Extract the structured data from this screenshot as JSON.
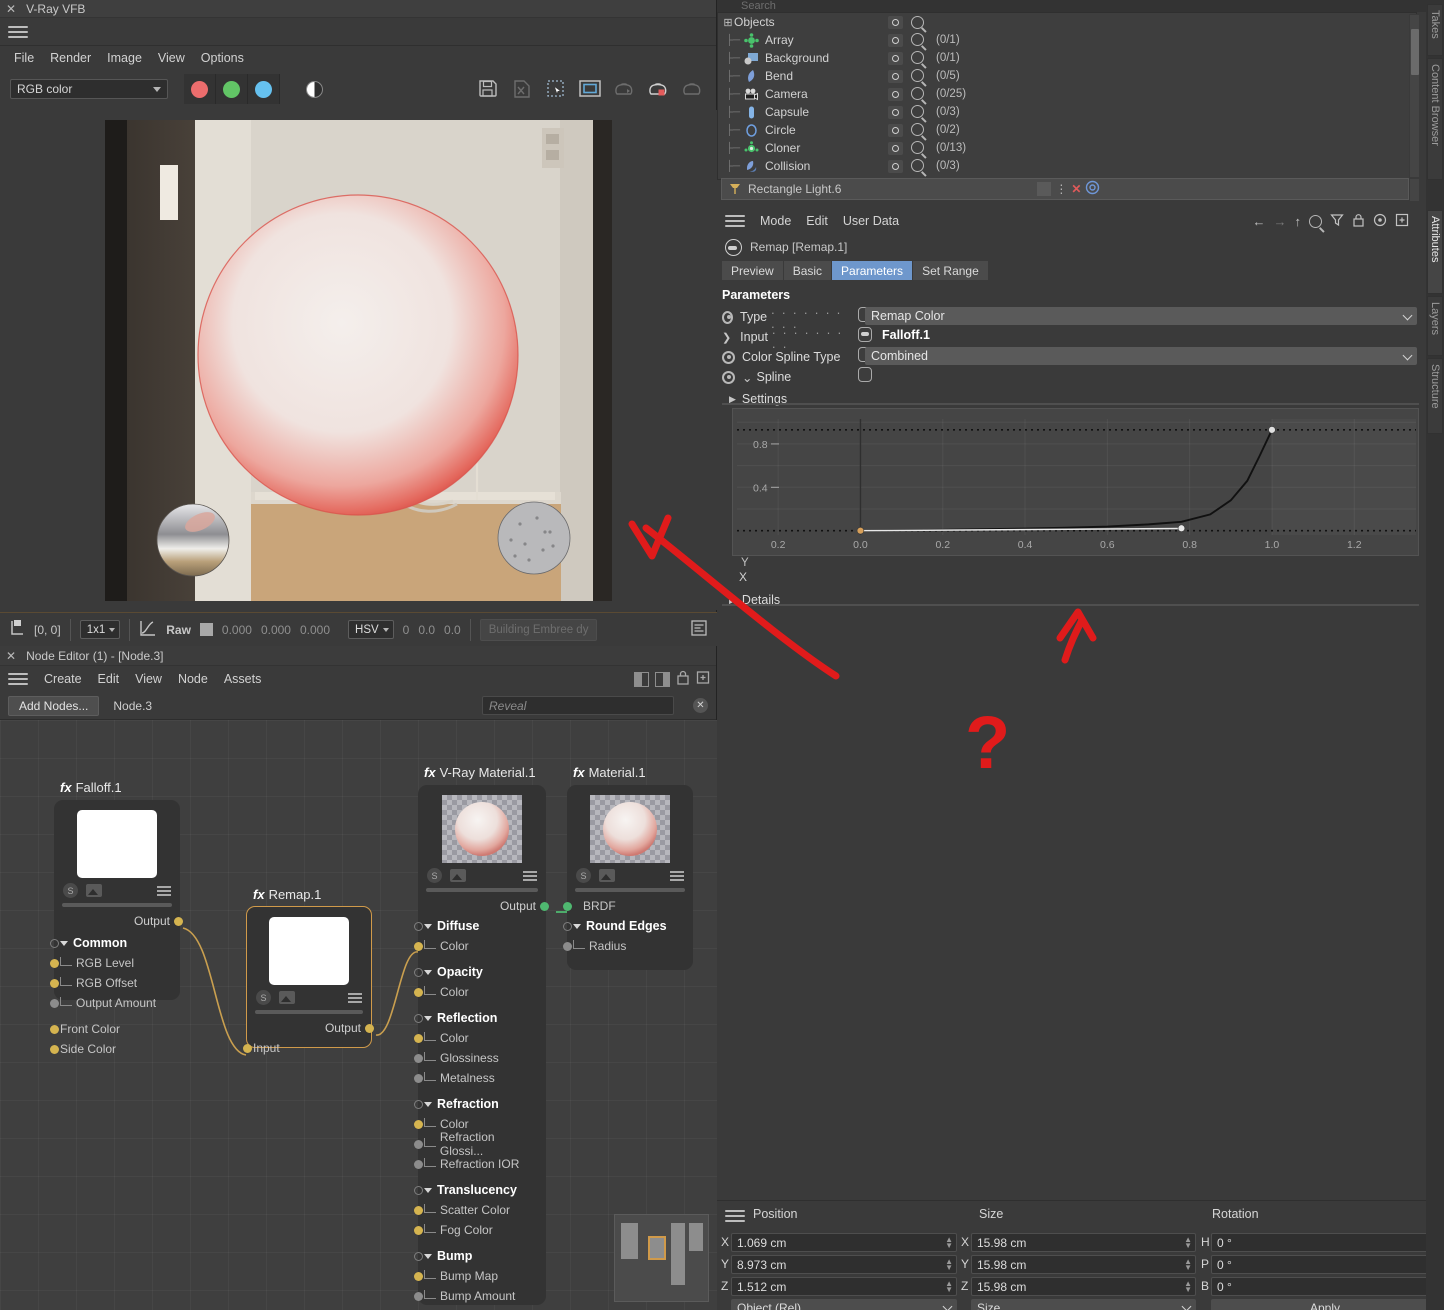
{
  "vfb": {
    "window_title": "V-Ray VFB",
    "close_icon": "close-icon",
    "menu": [
      "File",
      "Render",
      "Image",
      "View",
      "Options"
    ],
    "channel_select": "RGB color",
    "channel_buttons": [
      "red-channel",
      "green-channel",
      "blue-channel",
      "alpha-channel"
    ],
    "toolbar_icons": [
      "save-image-icon",
      "save-region-icon",
      "region-select-icon",
      "frame-icon",
      "teapot-render-icon",
      "teapot-region-icon",
      "teapot-stop-icon"
    ],
    "colors": {
      "red": "#ec6d6d",
      "green": "#62c566",
      "blue": "#66c1ef"
    },
    "status": {
      "pixel_coord": "[0, 0]",
      "zoom": "1x1",
      "mode_label": "Raw",
      "raw_values": [
        "0.000",
        "0.000",
        "0.000"
      ],
      "color_space": "HSV",
      "hsv_values": [
        "0",
        "0.0",
        "0.0"
      ],
      "progress_text": "Building Embree dy"
    }
  },
  "node_editor": {
    "title": "Node Editor (1) - [Node.3]",
    "menu": [
      "Create",
      "Edit",
      "View",
      "Node",
      "Assets"
    ],
    "add_nodes_label": "Add Nodes...",
    "node_path": "Node.3",
    "reveal_placeholder": "Reveal",
    "nodes": [
      {
        "id": "falloff",
        "prefix": "fx",
        "title": "Falloff.1",
        "selected": false,
        "thumb": "white",
        "out_label": "Output",
        "ports": [
          {
            "label": "Common",
            "group": true,
            "dot": "hollow"
          },
          {
            "label": "RGB Level",
            "group": false,
            "dot": "y"
          },
          {
            "label": "RGB Offset",
            "group": false,
            "dot": "y"
          },
          {
            "label": "Output Amount",
            "group": false,
            "dot": "gy"
          },
          {
            "label": "Front Color",
            "group": false,
            "dot": "y",
            "nolink": true
          },
          {
            "label": "Side Color",
            "group": false,
            "dot": "y",
            "nolink": true
          }
        ]
      },
      {
        "id": "remap",
        "prefix": "fx",
        "title": "Remap.1",
        "selected": true,
        "thumb": "white",
        "out_label": "Output",
        "in_label": "Input"
      },
      {
        "id": "vraymat",
        "prefix": "fx",
        "title": "V-Ray Material.1",
        "selected": false,
        "thumb": "sphere",
        "out_label": "Output",
        "ports": [
          {
            "label": "Diffuse",
            "group": true,
            "dot": "hollow"
          },
          {
            "label": "Color",
            "group": false,
            "dot": "y"
          },
          {
            "label": "Opacity",
            "group": true,
            "dot": "hollow"
          },
          {
            "label": "Color",
            "group": false,
            "dot": "y"
          },
          {
            "label": "Reflection",
            "group": true,
            "dot": "hollow"
          },
          {
            "label": "Color",
            "group": false,
            "dot": "y"
          },
          {
            "label": "Glossiness",
            "group": false,
            "dot": "gy"
          },
          {
            "label": "Metalness",
            "group": false,
            "dot": "gy"
          },
          {
            "label": "Refraction",
            "group": true,
            "dot": "hollow"
          },
          {
            "label": "Color",
            "group": false,
            "dot": "y"
          },
          {
            "label": "Refraction Glossi...",
            "group": false,
            "dot": "gy"
          },
          {
            "label": "Refraction IOR",
            "group": false,
            "dot": "gy"
          },
          {
            "label": "Translucency",
            "group": true,
            "dot": "hollow"
          },
          {
            "label": "Scatter Color",
            "group": false,
            "dot": "y"
          },
          {
            "label": "Fog Color",
            "group": false,
            "dot": "y"
          },
          {
            "label": "Bump",
            "group": true,
            "dot": "hollow"
          },
          {
            "label": "Bump Map",
            "group": false,
            "dot": "y"
          },
          {
            "label": "Bump Amount",
            "group": false,
            "dot": "gy"
          }
        ]
      },
      {
        "id": "material",
        "prefix": "fx",
        "title": "Material.1",
        "selected": false,
        "thumb": "sphere",
        "ports": [
          {
            "label": "BRDF",
            "group": false,
            "dot": "gr",
            "nolink": true
          },
          {
            "label": "Round Edges",
            "group": true,
            "dot": "hollow"
          },
          {
            "label": "Radius",
            "group": false,
            "dot": "gy"
          }
        ]
      }
    ]
  },
  "object_manager": {
    "search_placeholder": "Search",
    "root": "Objects",
    "items": [
      {
        "label": "Array",
        "count": "(0/1)",
        "icon": "array-icon",
        "color": "#49c26c"
      },
      {
        "label": "Background",
        "count": "(0/1)",
        "icon": "background-icon",
        "color": "#7fa9d4"
      },
      {
        "label": "Bend",
        "count": "(0/5)",
        "icon": "bend-icon",
        "color": "#7e9fd9"
      },
      {
        "label": "Camera",
        "count": "(0/25)",
        "icon": "camera-icon",
        "color": "#d8d8d8"
      },
      {
        "label": "Capsule",
        "count": "(0/3)",
        "icon": "capsule-icon",
        "color": "#85b4e6"
      },
      {
        "label": "Circle",
        "count": "(0/2)",
        "icon": "circle-icon",
        "color": "#6f9fe0"
      },
      {
        "label": "Cloner",
        "count": "(0/13)",
        "icon": "cloner-icon",
        "color": "#49c26c"
      },
      {
        "label": "Collision",
        "count": "(0/3)",
        "icon": "collision-icon",
        "color": "#7e9fd9"
      }
    ],
    "selected_object": "Rectangle Light.6"
  },
  "attributes": {
    "menu": [
      "Mode",
      "Edit",
      "User Data"
    ],
    "toolbar_icons": [
      "back-arrow-icon",
      "forward-arrow-icon",
      "up-arrow-icon",
      "search-icon",
      "filter-icon",
      "lock-icon",
      "target-icon",
      "new-window-icon"
    ],
    "object_header": "Remap [Remap.1]",
    "tabs": [
      {
        "label": "Preview",
        "active": false
      },
      {
        "label": "Basic",
        "active": false
      },
      {
        "label": "Parameters",
        "active": true
      },
      {
        "label": "Set Range",
        "active": false
      }
    ],
    "section_title": "Parameters",
    "rows": [
      {
        "label": "Type",
        "dots": ". . . . . . . . . .",
        "value": "Remap Color",
        "kind": "dropdown"
      },
      {
        "label": "Input",
        "dots": ". . . . . . . . .",
        "value": "Falloff.1",
        "kind": "link"
      },
      {
        "label": "Color Spline Type",
        "dots": "",
        "value": "Combined",
        "kind": "dropdown"
      },
      {
        "label": "Spline",
        "dots": "",
        "value": "",
        "kind": "collapse"
      }
    ],
    "settings_label": "Settings",
    "details_label": "Details",
    "accent": "#6e97cc"
  },
  "chart_data": {
    "type": "line",
    "title": "",
    "xlabel": "X",
    "ylabel": "Y",
    "xticks": [
      "0.2",
      "0.0",
      "0.2",
      "0.4",
      "0.6",
      "0.8",
      "1.0",
      "1.2"
    ],
    "yticks": [
      "0.8",
      "0.4"
    ],
    "xlim": [
      -0.3,
      1.35
    ],
    "ylim": [
      -0.04,
      1.03
    ],
    "series": [
      {
        "name": "spline",
        "color": "#111111",
        "x": [
          0.0,
          0.1,
          0.2,
          0.3,
          0.4,
          0.5,
          0.6,
          0.7,
          0.78,
          0.85,
          0.9,
          0.94,
          0.97,
          1.0
        ],
        "y": [
          0.0,
          0.004,
          0.008,
          0.013,
          0.019,
          0.027,
          0.038,
          0.058,
          0.082,
          0.15,
          0.28,
          0.46,
          0.69,
          0.93
        ]
      },
      {
        "name": "tangent-handle",
        "color": "#e8e8e8",
        "x": [
          0.0,
          0.78
        ],
        "y": [
          0.0,
          0.02
        ]
      }
    ],
    "points": [
      {
        "x": 0.0,
        "y": 0.0,
        "color": "#d8a05a"
      },
      {
        "x": 0.78,
        "y": 0.022,
        "color": "#e8e8e8"
      },
      {
        "x": 1.0,
        "y": 0.93,
        "color": "#e0e0e0"
      }
    ],
    "dotted_guides_y": [
      0.0,
      0.93
    ]
  },
  "coordinates": {
    "headers": [
      "Position",
      "Size",
      "Rotation"
    ],
    "position": {
      "labels": [
        "X",
        "Y",
        "Z"
      ],
      "values": [
        "1.069 cm",
        "8.973 cm",
        "1.512 cm"
      ]
    },
    "size": {
      "labels": [
        "X",
        "Y",
        "Z"
      ],
      "values": [
        "15.98 cm",
        "15.98 cm",
        "15.98 cm"
      ]
    },
    "rotation": {
      "labels": [
        "H",
        "P",
        "B"
      ],
      "values": [
        "0 °",
        "0 °",
        "0 °"
      ]
    },
    "mode_dropdown": "Object (Rel)",
    "size_dropdown": "Size",
    "apply_label": "Apply"
  },
  "side_tabs": {
    "top": [
      "Takes",
      "Content Browser"
    ],
    "bottom": [
      "Attributes",
      "Layers",
      "Structure"
    ],
    "active": "Attributes"
  },
  "annotations": {
    "color": "#e01b1b",
    "question_mark": "?",
    "marks": [
      "arrow-to-graph",
      "arrow-up",
      "question-mark"
    ]
  }
}
